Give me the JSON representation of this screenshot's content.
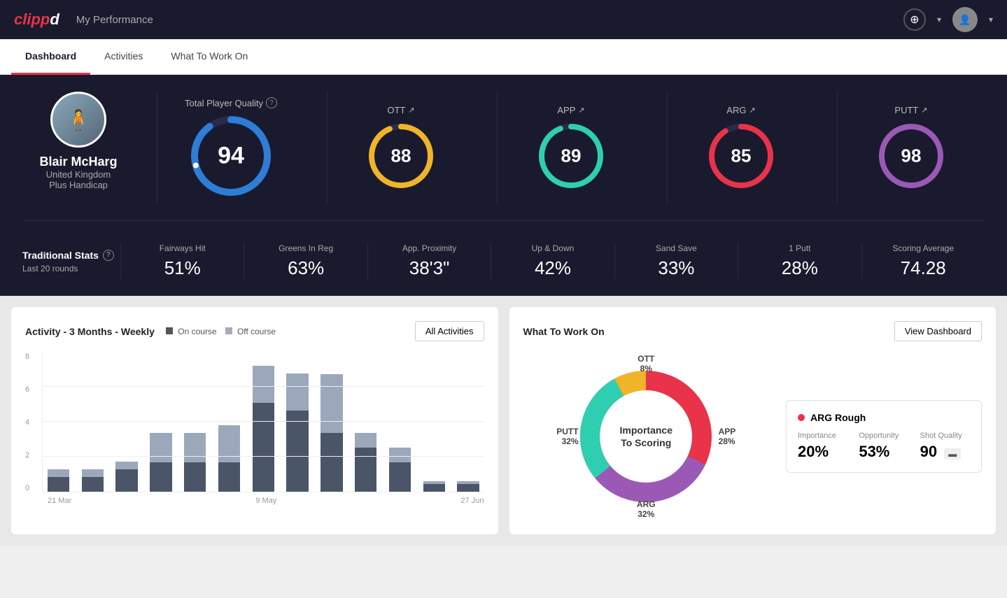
{
  "app": {
    "logo": "clippd",
    "header_title": "My Performance"
  },
  "tabs": [
    {
      "id": "dashboard",
      "label": "Dashboard",
      "active": true
    },
    {
      "id": "activities",
      "label": "Activities",
      "active": false
    },
    {
      "id": "what-to-work-on",
      "label": "What To Work On",
      "active": false
    }
  ],
  "player": {
    "name": "Blair McHarg",
    "country": "United Kingdom",
    "handicap": "Plus Handicap"
  },
  "total_quality": {
    "label": "Total Player Quality",
    "value": 94,
    "color": "#2e7dd6"
  },
  "scores": [
    {
      "id": "ott",
      "label": "OTT",
      "value": 88,
      "color": "#f0b429"
    },
    {
      "id": "app",
      "label": "APP",
      "value": 89,
      "color": "#2ecfb0"
    },
    {
      "id": "arg",
      "label": "ARG",
      "value": 85,
      "color": "#e8334a"
    },
    {
      "id": "putt",
      "label": "PUTT",
      "value": 98,
      "color": "#9b59b6"
    }
  ],
  "traditional_stats": {
    "title": "Traditional Stats",
    "subtitle": "Last 20 rounds",
    "items": [
      {
        "label": "Fairways Hit",
        "value": "51%"
      },
      {
        "label": "Greens In Reg",
        "value": "63%"
      },
      {
        "label": "App. Proximity",
        "value": "38'3\""
      },
      {
        "label": "Up & Down",
        "value": "42%"
      },
      {
        "label": "Sand Save",
        "value": "33%"
      },
      {
        "label": "1 Putt",
        "value": "28%"
      },
      {
        "label": "Scoring Average",
        "value": "74.28"
      }
    ]
  },
  "activity_chart": {
    "title": "Activity - 3 Months - Weekly",
    "legend": {
      "on_course": "On course",
      "off_course": "Off course"
    },
    "all_activities_btn": "All Activities",
    "y_labels": [
      "0",
      "2",
      "4",
      "6",
      "8"
    ],
    "x_labels": [
      "21 Mar",
      "9 May",
      "27 Jun"
    ],
    "bars": [
      {
        "on": 1,
        "off": 0.5
      },
      {
        "on": 1,
        "off": 0.5
      },
      {
        "on": 1.5,
        "off": 0.5
      },
      {
        "on": 2,
        "off": 2
      },
      {
        "on": 2,
        "off": 2
      },
      {
        "on": 2,
        "off": 2.5
      },
      {
        "on": 6,
        "off": 2.5
      },
      {
        "on": 5.5,
        "off": 2.5
      },
      {
        "on": 4,
        "off": 4
      },
      {
        "on": 3,
        "off": 1
      },
      {
        "on": 2,
        "off": 1
      },
      {
        "on": 0.5,
        "off": 0.2
      },
      {
        "on": 0.5,
        "off": 0.2
      }
    ]
  },
  "what_to_work_on": {
    "title": "What To Work On",
    "view_dashboard_btn": "View Dashboard",
    "center_text": "Importance\nTo Scoring",
    "segments": [
      {
        "label": "OTT",
        "value": "8%",
        "color": "#f0b429"
      },
      {
        "label": "APP",
        "value": "28%",
        "color": "#2ecfb0"
      },
      {
        "label": "ARG",
        "value": "32%",
        "color": "#e8334a"
      },
      {
        "label": "PUTT",
        "value": "32%",
        "color": "#9b59b6"
      }
    ],
    "detail_card": {
      "title": "ARG Rough",
      "color": "#e8334a",
      "importance_label": "Importance",
      "importance_value": "20%",
      "opportunity_label": "Opportunity",
      "opportunity_value": "53%",
      "shot_quality_label": "Shot Quality",
      "shot_quality_value": "90"
    }
  }
}
